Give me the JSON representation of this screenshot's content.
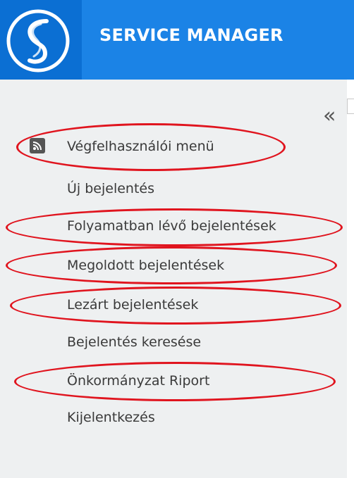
{
  "header": {
    "title": "SERVICE MANAGER",
    "logo_icon": "service-manager-s-logo",
    "accent_color": "#1b83e6"
  },
  "sidebar": {
    "collapse_glyph": "«",
    "items": [
      {
        "label": "Végfelhasználói menü",
        "icon": "rss-icon"
      },
      {
        "label": "Új bejelentés"
      },
      {
        "label": "Folyamatban lévő bejelentések"
      },
      {
        "label": "Megoldott bejelentések"
      },
      {
        "label": "Lezárt bejelentések"
      },
      {
        "label": "Bejelentés keresése"
      },
      {
        "label": "Önkormányzat Riport"
      },
      {
        "label": "Kijelentkezés"
      }
    ]
  },
  "annotation_color": "#e0141e"
}
